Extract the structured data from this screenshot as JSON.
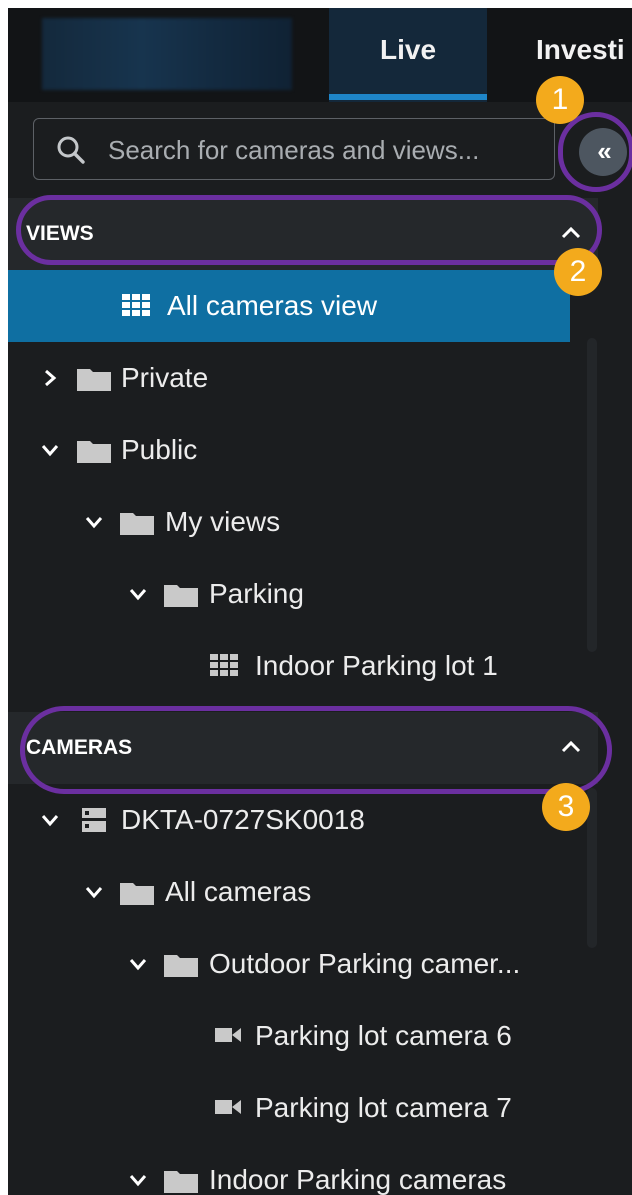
{
  "header": {
    "tabs": [
      {
        "label": "Live",
        "active": true
      },
      {
        "label": "Investi",
        "active": false
      }
    ]
  },
  "search": {
    "placeholder": "Search for cameras and views...",
    "value": "",
    "collapse_icon": "«"
  },
  "views": {
    "title": "VIEWS",
    "items": [
      {
        "label": "All cameras view",
        "icon": "grid-view-icon",
        "selected": true
      },
      {
        "label": "Private",
        "icon": "folder-icon",
        "expanded": false
      },
      {
        "label": "Public",
        "icon": "folder-icon",
        "expanded": true
      },
      {
        "label": "My views",
        "icon": "folder-icon",
        "expanded": true
      },
      {
        "label": "Parking",
        "icon": "folder-icon",
        "expanded": true
      },
      {
        "label": "Indoor Parking lot 1",
        "icon": "grid-view-icon"
      }
    ]
  },
  "cameras": {
    "title": "CAMERAS",
    "items": [
      {
        "label": "DKTA-0727SK0018",
        "icon": "server-icon",
        "expanded": true
      },
      {
        "label": "All cameras",
        "icon": "folder-icon",
        "expanded": true
      },
      {
        "label": "Outdoor Parking camer...",
        "icon": "folder-icon",
        "expanded": true
      },
      {
        "label": "Parking lot camera 6",
        "icon": "video-camera-icon"
      },
      {
        "label": "Parking lot camera 7",
        "icon": "video-camera-icon"
      },
      {
        "label": "Indoor Parking cameras",
        "icon": "folder-icon",
        "expanded": true
      }
    ]
  },
  "annotations": [
    "1",
    "2",
    "3"
  ],
  "colors": {
    "selected_row": "#0f6fa2",
    "active_tab_underline": "#1e86c9",
    "callout_ring": "#6b2fa0",
    "callout_badge": "#f3aa1c"
  }
}
